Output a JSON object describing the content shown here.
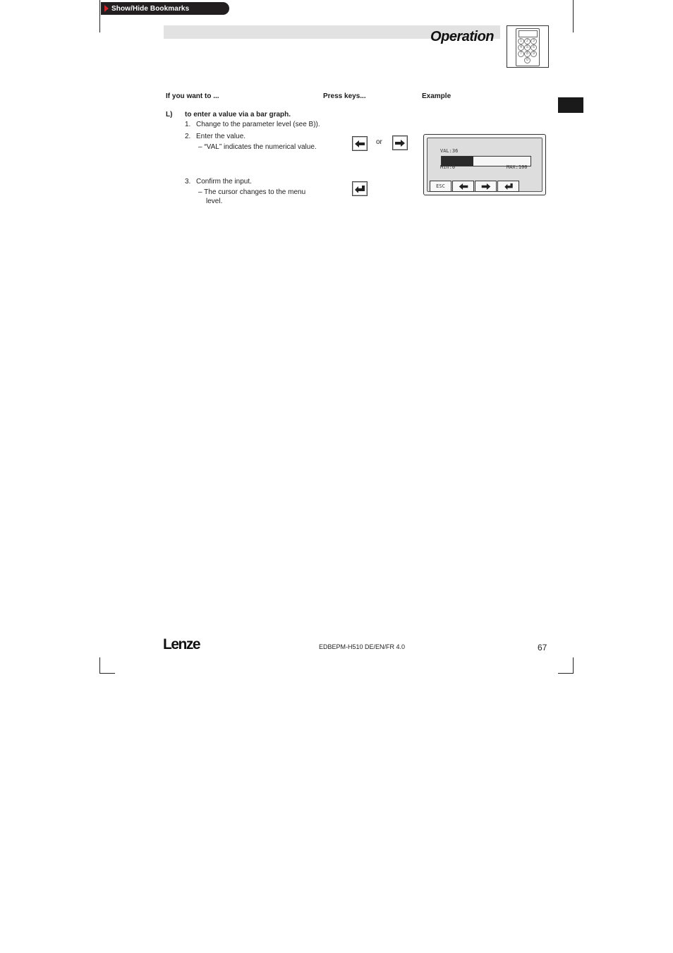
{
  "bookmarks": {
    "label": "Show/Hide Bookmarks"
  },
  "header": {
    "title": "Operation"
  },
  "keypad_icon": {
    "keys": [
      "1",
      "2",
      "3",
      "4",
      "5",
      "6",
      "7",
      "8",
      "9",
      "0"
    ]
  },
  "columns": {
    "want": "If you want to ...",
    "press": "Press keys...",
    "example": "Example"
  },
  "section": {
    "letter": "L)",
    "heading": "to enter a value via a bar graph.",
    "steps": [
      {
        "num": "1.",
        "text": "Change to the parameter level (see B))."
      },
      {
        "num": "2.",
        "text": "Enter the value.",
        "sub": [
          "– “VAL” indicates the numerical value."
        ]
      },
      {
        "num": "3.",
        "text": "Confirm the input.",
        "sub": [
          "– The cursor changes to the menu",
          "level."
        ]
      }
    ],
    "or_text": "or"
  },
  "lcd": {
    "val_text": "VAL:36",
    "min_text": "Min:0",
    "max_text": "MAX:100",
    "value": 36,
    "min": 0,
    "max": 100,
    "esc_label": "ESC"
  },
  "footer": {
    "logo": "Lenze",
    "doc_code": "EDBEPM-H510 DE/EN/FR 4.0",
    "page_number": "67"
  }
}
